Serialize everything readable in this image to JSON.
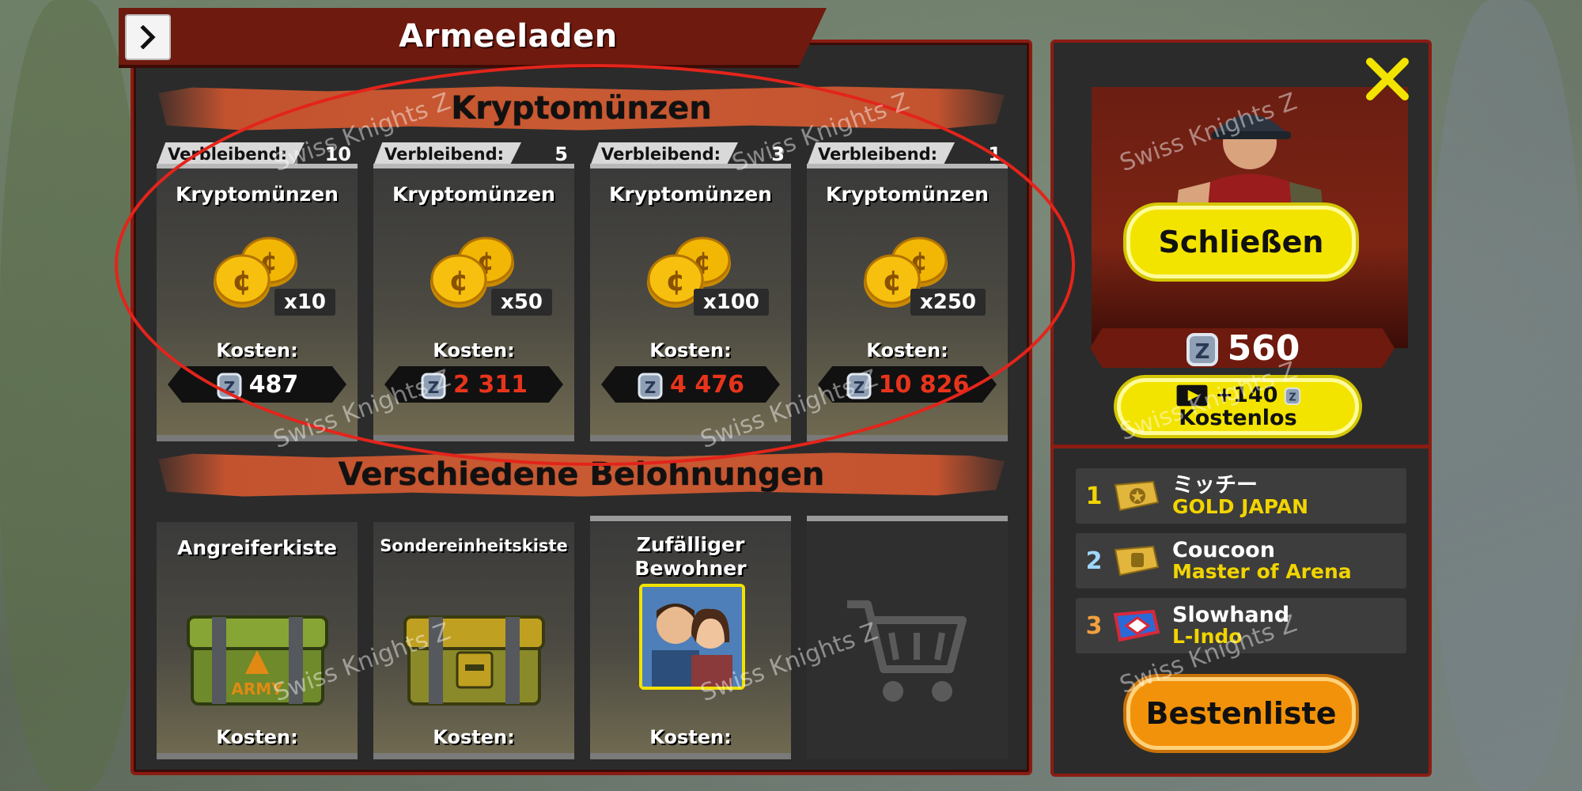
{
  "window": {
    "title": "Armeeladen"
  },
  "sections": {
    "crypto_title": "Kryptomünzen",
    "rewards_title": "Verschiedene Belohnungen"
  },
  "crypto_cards": [
    {
      "remaining_label": "Verbleibend:",
      "remaining": "10",
      "name": "Kryptomünzen",
      "qty": "x10",
      "cost_label": "Kosten:",
      "price": "487",
      "price_color": "#ffffff"
    },
    {
      "remaining_label": "Verbleibend:",
      "remaining": "5",
      "name": "Kryptomünzen",
      "qty": "x50",
      "cost_label": "Kosten:",
      "price": "2 311",
      "price_color": "#e8341c"
    },
    {
      "remaining_label": "Verbleibend:",
      "remaining": "3",
      "name": "Kryptomünzen",
      "qty": "x100",
      "cost_label": "Kosten:",
      "price": "4 476",
      "price_color": "#e8341c"
    },
    {
      "remaining_label": "Verbleibend:",
      "remaining": "1",
      "name": "Kryptomünzen",
      "qty": "x250",
      "cost_label": "Kosten:",
      "price": "10 826",
      "price_color": "#e8341c"
    }
  ],
  "reward_cards": [
    {
      "name": "Angreiferkiste",
      "cost_label": "Kosten:",
      "icon": "army-chest-icon"
    },
    {
      "name": "Sondereinheitskiste",
      "cost_label": "Kosten:",
      "icon": "special-chest-icon"
    },
    {
      "name": "Zufälliger Bewohner",
      "cost_label": "Kosten:",
      "icon": "resident-portrait-icon"
    },
    {
      "name": "",
      "icon": "shopping-cart-icon"
    }
  ],
  "side": {
    "close_label": "Schließen",
    "balance": "560",
    "free_bonus": "+140",
    "free_label": "Kostenlos",
    "leaderboard_label": "Bestenliste",
    "ranking": [
      {
        "rank": "1",
        "player": "ミッチー",
        "clan": "GOLD JAPAN",
        "rank_color": "#f2d400"
      },
      {
        "rank": "2",
        "player": "Coucoon",
        "clan": "Master of Arena",
        "rank_color": "#9fd8ff"
      },
      {
        "rank": "3",
        "player": "Slowhand",
        "clan": "L-Indo",
        "rank_color": "#f2a040"
      }
    ]
  },
  "watermark": "Swiss Knights Z",
  "colors": {
    "panel_border": "#8a1c12",
    "accent_yellow": "#f3e400",
    "accent_orange": "#f2920a",
    "price_red": "#e8341c"
  }
}
